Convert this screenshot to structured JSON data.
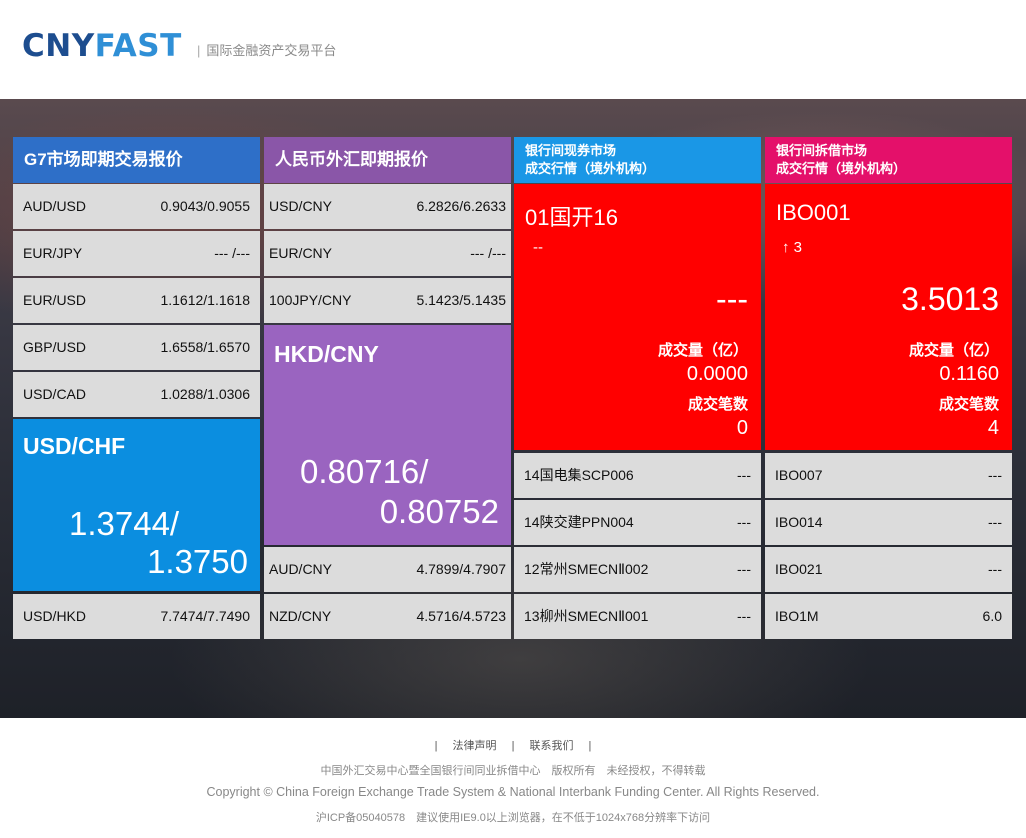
{
  "header": {
    "logo_part1": "CNY",
    "logo_part2": "FAST",
    "separator": "|",
    "tagline": "国际金融资产交易平台"
  },
  "colors": {
    "g7_blue": "#2e6fc8",
    "usdchf_blue": "#0b8ee0",
    "rmb_purple": "#8a56a8",
    "hkd_purple": "#9a64c0",
    "bond_blue": "#1a97e6",
    "lend_magenta": "#e4106a",
    "quote_red": "#ff0000",
    "row_gray": "#dcdcdc"
  },
  "g7": {
    "title": "G7市场即期交易报价",
    "rows": [
      {
        "pair": "AUD/USD",
        "quote": "0.9043/0.9055"
      },
      {
        "pair": "EUR/JPY",
        "quote": "--- /---"
      },
      {
        "pair": "EUR/USD",
        "quote": "1.1612/1.1618"
      },
      {
        "pair": "GBP/USD",
        "quote": "1.6558/1.6570"
      },
      {
        "pair": "USD/CAD",
        "quote": "1.0288/1.0306"
      }
    ],
    "featured": {
      "pair": "USD/CHF",
      "bid": "1.3744/",
      "ask": "1.3750"
    },
    "last": {
      "pair": "USD/HKD",
      "quote": "7.7474/7.7490"
    }
  },
  "rmb": {
    "title": "人民币外汇即期报价",
    "rows": [
      {
        "pair": "USD/CNY",
        "quote": "6.2826/6.2633"
      },
      {
        "pair": "EUR/CNY",
        "quote": "--- /---"
      },
      {
        "pair": "100JPY/CNY",
        "quote": "5.1423/5.1435"
      }
    ],
    "featured": {
      "pair": "HKD/CNY",
      "bid": "0.80716/",
      "ask": "0.80752"
    },
    "bottom": [
      {
        "pair": "AUD/CNY",
        "quote": "4.7899/4.7907"
      },
      {
        "pair": "NZD/CNY",
        "quote": "4.5716/4.5723"
      }
    ]
  },
  "bond": {
    "title_line1": "银行间现券市场",
    "title_line2": "成交行情（境外机构）",
    "featured": {
      "code": "01国开16",
      "change": "--",
      "rate": "---",
      "volume_label": "成交量（亿）",
      "volume": "0.0000",
      "count_label": "成交笔数",
      "count": "0"
    },
    "rows": [
      {
        "name": "14国电集SCP006",
        "value": "---"
      },
      {
        "name": "14陕交建PPN004",
        "value": "---"
      },
      {
        "name": "12常州SMECNⅡ002",
        "value": "---"
      },
      {
        "name": "13柳州SMECNⅡ001",
        "value": "---"
      }
    ]
  },
  "lending": {
    "title_line1": "银行间拆借市场",
    "title_line2": "成交行情（境外机构）",
    "featured": {
      "code": "IBO001",
      "change_arrow": "↑",
      "change": "3",
      "rate": "3.5013",
      "volume_label": "成交量（亿）",
      "volume": "0.1160",
      "count_label": "成交笔数",
      "count": "4"
    },
    "rows": [
      {
        "name": "IBO007",
        "value": "---"
      },
      {
        "name": "IBO014",
        "value": "---"
      },
      {
        "name": "IBO021",
        "value": "---"
      },
      {
        "name": "IBO1M",
        "value": "6.0"
      }
    ]
  },
  "footer": {
    "divider": "|",
    "link_legal": "法律声明",
    "link_contact": "联系我们",
    "org_line": "中国外汇交易中心暨全国银行间同业拆借中心　版权所有　未经授权，不得转载",
    "copyright": "Copyright © China Foreign Exchange Trade System & National Interbank Funding Center. All Rights Reserved.",
    "icp_line": "沪ICP备05040578　建议使用IE9.0以上浏览器，在不低于1024x768分辨率下访问"
  }
}
